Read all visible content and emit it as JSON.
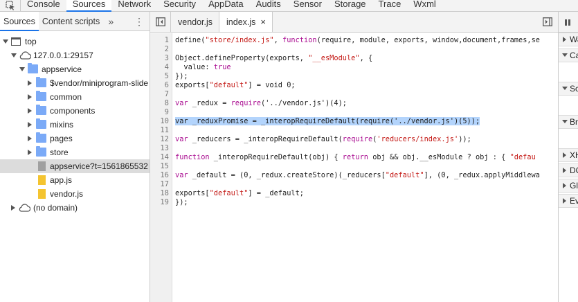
{
  "top_tabs": [
    {
      "label": "Console"
    },
    {
      "label": "Sources"
    },
    {
      "label": "Network"
    },
    {
      "label": "Security"
    },
    {
      "label": "AppData"
    },
    {
      "label": "Audits"
    },
    {
      "label": "Sensor"
    },
    {
      "label": "Storage"
    },
    {
      "label": "Trace"
    },
    {
      "label": "Wxml"
    }
  ],
  "active_top_tab": "Sources",
  "accent_color": "#1a73e8",
  "navigator": {
    "tabs": [
      {
        "label": "Sources"
      },
      {
        "label": "Content scripts"
      }
    ],
    "more_label": "»",
    "menu_label": "⋮",
    "tree": [
      {
        "label": "top"
      },
      {
        "label": "127.0.0.1:29157"
      },
      {
        "label": "appservice"
      },
      {
        "label": "$vendor/miniprogram-slide"
      },
      {
        "label": "common"
      },
      {
        "label": "components"
      },
      {
        "label": "mixins"
      },
      {
        "label": "pages"
      },
      {
        "label": "store"
      },
      {
        "label": "appservice?t=1561865532"
      },
      {
        "label": "app.js"
      },
      {
        "label": "vendor.js"
      },
      {
        "label": "(no domain)"
      }
    ]
  },
  "editor": {
    "tabs": [
      {
        "label": "vendor.js"
      },
      {
        "label": "index.js"
      }
    ],
    "close_label": "×",
    "line_numbers": [
      "1",
      "2",
      "3",
      "4",
      "5",
      "6",
      "7",
      "8",
      "9",
      "10",
      "11",
      "12",
      "13",
      "14",
      "15",
      "16",
      "17",
      "18",
      "19"
    ],
    "highlighted_line": 10
  },
  "right_pane": {
    "sections": [
      {
        "label": "Wa"
      },
      {
        "label": "Ca"
      },
      {
        "label": "Sc"
      },
      {
        "label": "Br"
      },
      {
        "label": "XH"
      },
      {
        "label": "DO"
      },
      {
        "label": "Gl"
      },
      {
        "label": "Ev"
      }
    ]
  },
  "code": {
    "l1": [
      "define(",
      "\"store/index.js\"",
      ", ",
      "function",
      "(require, module, exports, window,document,frames,se"
    ],
    "l3": [
      "Object.defineProperty(exports, ",
      "\"__esModule\"",
      ", {"
    ],
    "l4": [
      "  value: ",
      "true"
    ],
    "l5": [
      "});"
    ],
    "l6": [
      "exports[",
      "\"default\"",
      "] = void 0;"
    ],
    "l8": [
      "var",
      " _redux = ",
      "require",
      "('../vendor.js')(4);"
    ],
    "l10": [
      "var _reduxPromise = _interopRequireDefault(require('../vendor.js')(5));"
    ],
    "l12": [
      "var",
      " _reducers = _interopRequireDefault(",
      "require",
      "(",
      "'reducers/index.js'",
      "));"
    ],
    "l14": [
      "function",
      " _interopRequireDefault(obj) { ",
      "return",
      " obj && obj.__esModule ? obj : { ",
      "\"defau"
    ],
    "l16": [
      "var",
      " _default = (0, _redux.createStore)(_reducers[",
      "\"default\"",
      "], (0, _redux.applyMiddlewa"
    ],
    "l18": [
      "exports[",
      "\"default\"",
      "] = _default;"
    ],
    "l19": [
      "});"
    ]
  }
}
